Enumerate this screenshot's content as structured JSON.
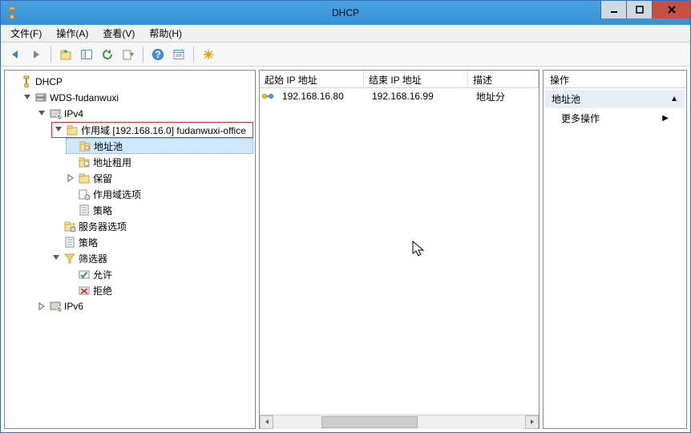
{
  "window": {
    "title": "DHCP"
  },
  "menu": {
    "file": "文件(F)",
    "action": "操作(A)",
    "view": "查看(V)",
    "help": "帮助(H)"
  },
  "tree": {
    "root": "DHCP",
    "server": "WDS-fudanwuxi",
    "ipv4": "IPv4",
    "scope": "作用域 [192.168.16.0] fudanwuxi-office",
    "address_pool": "地址池",
    "leases": "地址租用",
    "reservations": "保留",
    "scope_options": "作用域选项",
    "policies_scope": "策略",
    "server_options": "服务器选项",
    "policies_server": "策略",
    "filters": "筛选器",
    "allow": "允许",
    "deny": "拒绝",
    "ipv6": "IPv6"
  },
  "list": {
    "columns": {
      "start": "起始 IP 地址",
      "end": "结束 IP 地址",
      "desc": "描述"
    },
    "rows": [
      {
        "start": "192.168.16.80",
        "end": "192.168.16.99",
        "desc": "地址分"
      }
    ]
  },
  "actions": {
    "header": "操作",
    "section": "地址池",
    "more": "更多操作"
  }
}
